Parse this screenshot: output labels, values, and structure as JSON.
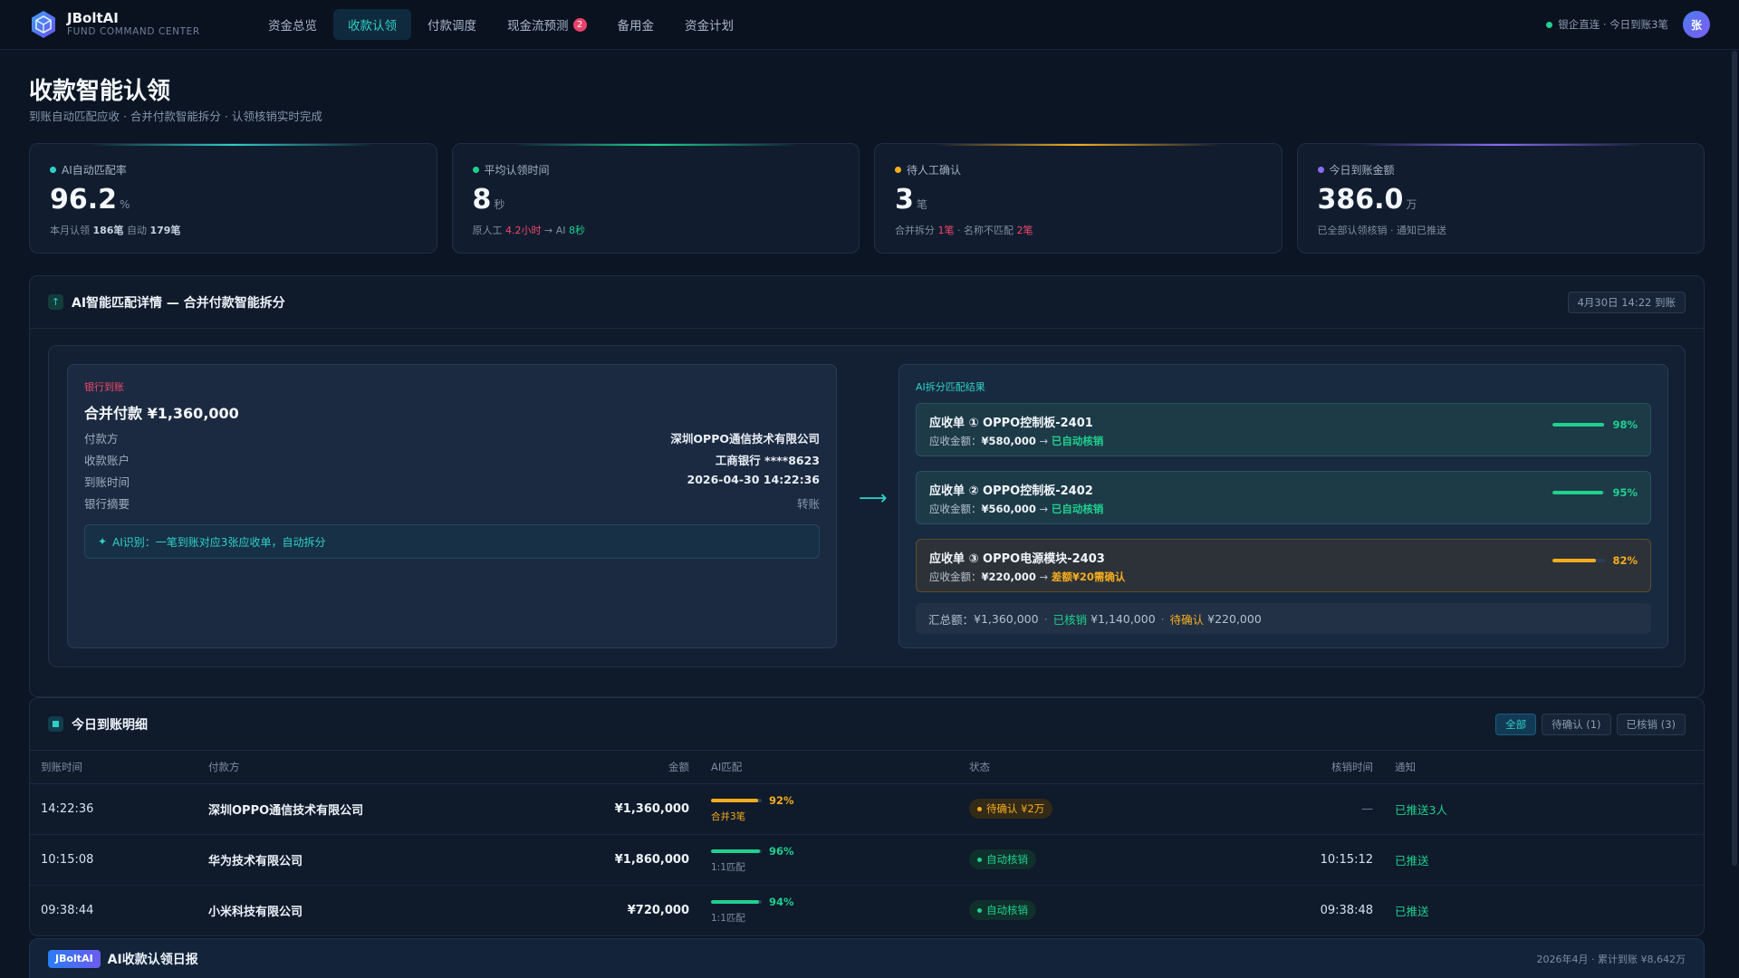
{
  "brand": {
    "name": "JBoltAI",
    "subtitle": "FUND COMMAND CENTER"
  },
  "nav": {
    "items": [
      {
        "label": "资金总览",
        "active": false
      },
      {
        "label": "收款认领",
        "active": true
      },
      {
        "label": "付款调度",
        "active": false
      },
      {
        "label": "现金流预测",
        "active": false,
        "badge": "2"
      },
      {
        "label": "备用金",
        "active": false
      },
      {
        "label": "资金计划",
        "active": false
      }
    ],
    "bank_status": "银企直连 · 今日到账3笔",
    "avatar": "张"
  },
  "page": {
    "title": "收款智能认领",
    "subtitle": "到账自动匹配应收 · 合并付款智能拆分 · 认领核销实时完成"
  },
  "kpis": [
    {
      "label": "AI自动匹配率",
      "value": "96.2",
      "unit": "%",
      "dot": "#2fd0c6",
      "sub": [
        {
          "t": "本月认领 "
        },
        {
          "t": "186笔",
          "b": true
        },
        {
          "t": " 自动 "
        },
        {
          "t": "179笔",
          "b": true
        }
      ]
    },
    {
      "label": "平均认领时间",
      "value": "8",
      "unit": "秒",
      "dot": "#1fd08e",
      "sub": [
        {
          "t": "原人工 "
        },
        {
          "t": "4.2小时",
          "c": "red"
        },
        {
          "t": " → AI "
        },
        {
          "t": "8秒",
          "c": "green"
        }
      ]
    },
    {
      "label": "待人工确认",
      "value": "3",
      "unit": "笔",
      "dot": "#f5ad1e",
      "sub": [
        {
          "t": "合并拆分 "
        },
        {
          "t": "1笔",
          "c": "red"
        },
        {
          "t": " · 名称不匹配 "
        },
        {
          "t": "2笔",
          "c": "red"
        }
      ]
    },
    {
      "label": "今日到账金额",
      "value": "386.0",
      "unit": "万",
      "dot": "#8b6cf6",
      "sub": [
        {
          "t": "已全部认领核销 · 通知已推送"
        }
      ]
    }
  ],
  "ai_panel": {
    "title": "AI智能匹配详情 — 合并付款智能拆分",
    "tag": "4月30日 14:22 到账",
    "bank": {
      "tag": "银行到账",
      "amount": "合并付款 ¥1,360,000",
      "rows": [
        {
          "k": "付款方",
          "v": "深圳OPPO通信技术有限公司"
        },
        {
          "k": "收款账户",
          "v": "工商银行 ****8623"
        },
        {
          "k": "到账时间",
          "v": "2026-04-30 14:22:36"
        },
        {
          "k": "银行摘要",
          "v": "转账",
          "muted": true
        }
      ],
      "hint": "AI识别：一笔到账对应3张应收单，自动拆分"
    },
    "result": {
      "tag": "AI拆分匹配结果",
      "matches": [
        {
          "title": "应收单 ① OPPO控制板-2401",
          "label": "应收金额：",
          "amount": "¥580,000",
          "arrow": " → ",
          "status": "已自动核销",
          "state": "ok",
          "pct": 98,
          "pct_label": "98%"
        },
        {
          "title": "应收单 ② OPPO控制板-2402",
          "label": "应收金额：",
          "amount": "¥560,000",
          "arrow": " → ",
          "status": "已自动核销",
          "state": "ok",
          "pct": 95,
          "pct_label": "95%"
        },
        {
          "title": "应收单 ③ OPPO电源模块-2403",
          "label": "应收金额：",
          "amount": "¥220,000",
          "arrow": " → ",
          "status": "差额¥20需确认",
          "state": "warn",
          "pct": 82,
          "pct_label": "82%"
        }
      ],
      "summary": {
        "total_label": "汇总额：",
        "total": "¥1,360,000",
        "done_label": "已核销",
        "done": "¥1,140,000",
        "pending_label": "待确认",
        "pending": "¥220,000"
      }
    }
  },
  "table": {
    "title": "今日到账明细",
    "filters": [
      {
        "label": "全部",
        "active": true
      },
      {
        "label": "待确认 (1)",
        "active": false
      },
      {
        "label": "已核销 (3)",
        "active": false
      }
    ],
    "columns": [
      "到账时间",
      "付款方",
      "金额",
      "AI匹配",
      "状态",
      "核销时间",
      "通知"
    ],
    "rows": [
      {
        "time": "14:22:36",
        "payer": "深圳OPPO通信技术有限公司",
        "amount": "¥1,360,000",
        "ai_pct": 92,
        "ai_label": "92%",
        "ai_sub": "合并3笔",
        "status": "待确认 ¥2万",
        "state": "pending",
        "done_time": "—",
        "notify": "已推送3人"
      },
      {
        "time": "10:15:08",
        "payer": "华为技术有限公司",
        "amount": "¥1,860,000",
        "ai_pct": 96,
        "ai_label": "96%",
        "ai_sub": "1:1匹配",
        "status": "自动核销",
        "state": "done",
        "done_time": "10:15:12",
        "notify": "已推送"
      },
      {
        "time": "09:38:44",
        "payer": "小米科技有限公司",
        "amount": "¥720,000",
        "ai_pct": 94,
        "ai_label": "94%",
        "ai_sub": "1:1匹配",
        "status": "自动核销",
        "state": "done",
        "done_time": "09:38:48",
        "notify": "已推送"
      }
    ]
  },
  "footer": {
    "badge": "JBoltAI",
    "title": "AI收款认领日报",
    "right": "2026年4月 · 累计到账 ¥8,642万"
  },
  "colors": {
    "accent": "#2fd0c6",
    "green": "#1fd08e",
    "amber": "#f5ad1e",
    "red": "#f0476a",
    "purple": "#8b6cf6"
  },
  "icons": [
    "brand-logo-icon",
    "ai-chip-icon",
    "table-square-icon",
    "sparkle-icon",
    "arrow-right-icon"
  ]
}
